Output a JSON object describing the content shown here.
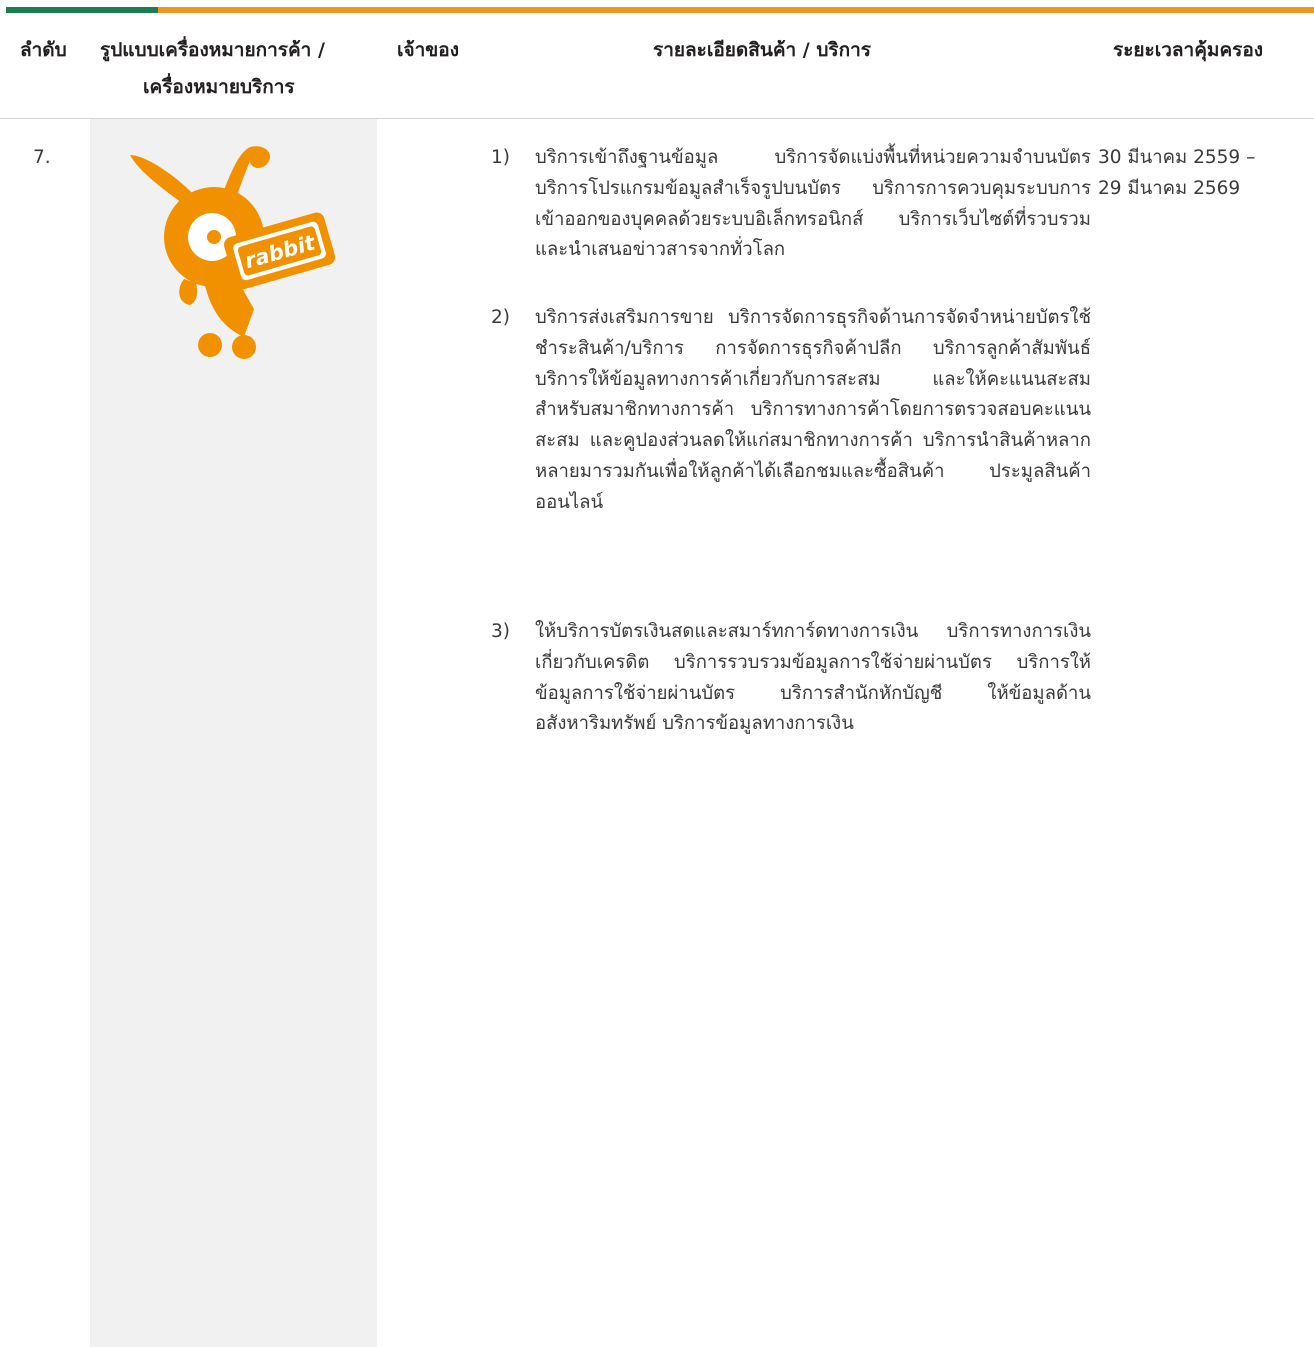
{
  "header": {
    "col_order": "ลำดับ",
    "col_mark_line1": "รูปแบบเครื่องหมายการค้า /",
    "col_mark_line2": "เครื่องหมายบริการ",
    "col_owner": "เจ้าของ",
    "col_details": "รายละเอียดสินค้า / บริการ",
    "col_period": "ระยะเวลาคุ้มครอง"
  },
  "row": {
    "order": "7.",
    "logo_text": "rabbit",
    "owner": "",
    "period_line1": "30 มีนาคม 2559 –",
    "period_line2": "29 มีนาคม 2569",
    "items": [
      {
        "num": "1)",
        "text": "บริการเข้าถึงฐานข้อมูล บริการจัดแบ่งพื้นที่หน่วยความจำบนบัตร บริการโปรแกรมข้อมูลสำเร็จรูปบนบัตร บริการการควบคุมระบบการเข้าออกของบุคคลด้วยระบบอิเล็กทรอนิกส์ บริการเว็บไซต์ที่รวบรวมและนำเสนอข่าวสารจากทั่วโลก"
      },
      {
        "num": "2)",
        "text": "บริการส่งเสริมการขาย บริการจัดการธุรกิจด้านการจัดจำหน่ายบัตรใช้ชำระสินค้า/บริการ การจัดการธุรกิจค้าปลีก บริการลูกค้าสัมพันธ์ บริการให้ข้อมูลทางการค้าเกี่ยวกับการสะสม และให้คะแนนสะสมสำหรับสมาชิกทางการค้า บริการทางการค้าโดยการตรวจสอบคะแนนสะสม และคูปองส่วนลดให้แก่สมาชิกทางการค้า บริการนำสินค้าหลากหลายมารวมกันเพื่อให้ลูกค้าได้เลือกชมและซื้อสินค้า ประมูลสินค้าออนไลน์"
      },
      {
        "num": "3)",
        "text": "ให้บริการบัตรเงินสดและสมาร์ทการ์ดทางการเงิน บริการทางการเงินเกี่ยวกับเครดิต บริการรวบรวมข้อมูลการใช้จ่ายผ่านบัตร บริการให้ข้อมูลการใช้จ่ายผ่านบัตร บริการสำนักหักบัญชี ให้ข้อมูลด้านอสังหาริมทรัพย์ บริการข้อมูลทางการเงิน"
      }
    ]
  },
  "colors": {
    "green": "#1a7f4f",
    "orange": "#ee9522",
    "mascot": "#f29100"
  }
}
